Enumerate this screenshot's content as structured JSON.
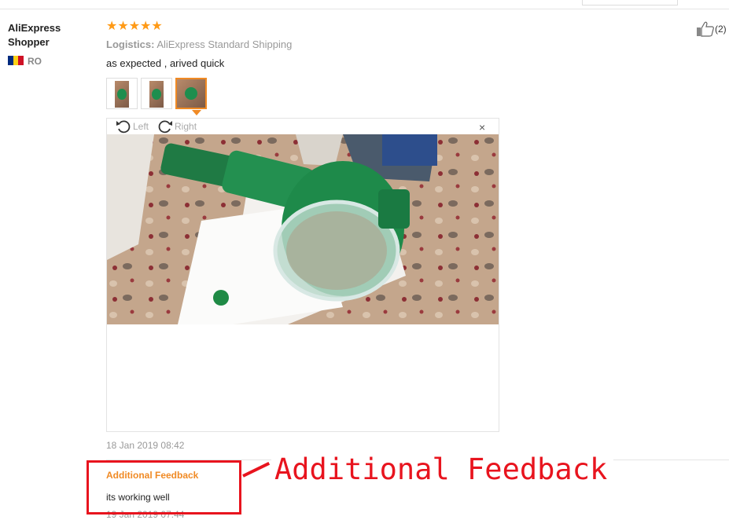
{
  "reviewer": {
    "name": "AliExpress Shopper",
    "country": "RO",
    "flag_colors": [
      "#002b7f",
      "#fcd116",
      "#ce1126"
    ]
  },
  "review": {
    "stars": "★★★★★",
    "rating": 5,
    "logistics_label": "Logistics:",
    "logistics_value": "AliExpress Standard Shipping",
    "text": "as expected , arived quick",
    "helpful_count": "(2)",
    "date": "18 Jan 2019 08:42"
  },
  "viewer": {
    "rotate_left_label": "Left",
    "rotate_right_label": "Right",
    "close_symbol": "×",
    "active_thumbnail": 3
  },
  "additional": {
    "title": "Additional Feedback",
    "text": "its working well",
    "date": "19 Jan 2019 07:44"
  },
  "annotation": {
    "label": "Additional Feedback",
    "color": "#e8141e"
  },
  "colors": {
    "accent": "#f08a24",
    "star": "#ff9a16"
  }
}
